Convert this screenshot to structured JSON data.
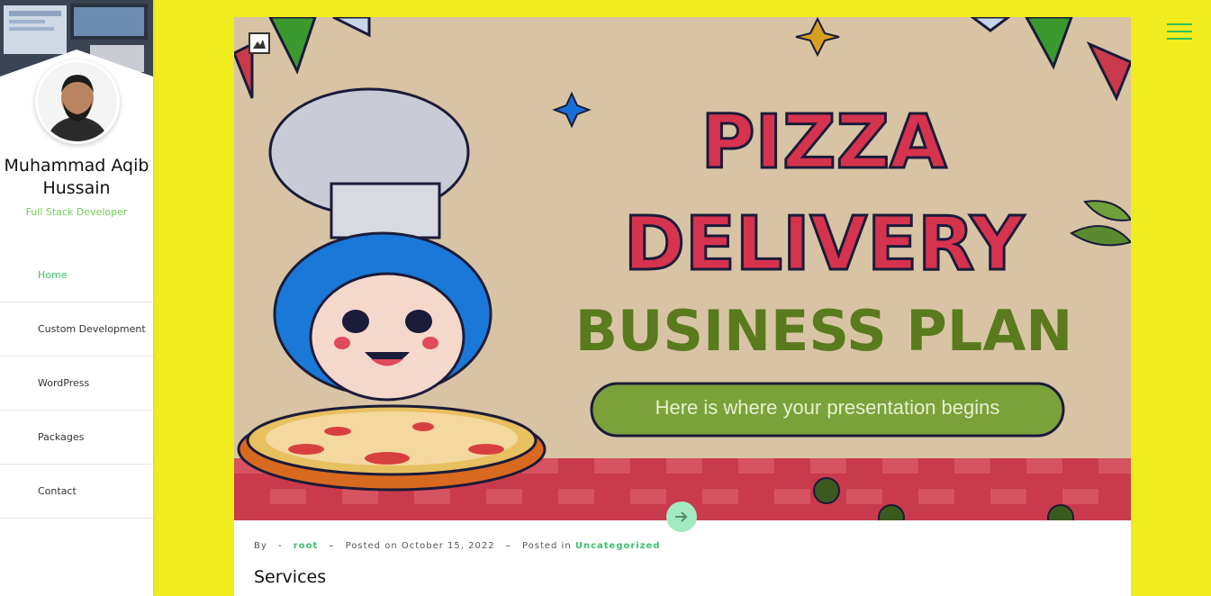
{
  "profile": {
    "name": "Muhammad Aqib Hussain",
    "role": "Full Stack Developer"
  },
  "nav": {
    "items": [
      {
        "label": "Home",
        "active": true
      },
      {
        "label": "Custom Development",
        "active": false
      },
      {
        "label": "WordPress",
        "active": false
      },
      {
        "label": "Packages",
        "active": false
      },
      {
        "label": "Contact",
        "active": false
      }
    ]
  },
  "hero": {
    "title_line1": "PIZZA",
    "title_line2": "DELIVERY",
    "title_line3": "BUSINESS PLAN",
    "subtitle": "Here is where your presentation begins"
  },
  "post": {
    "by_label": "By",
    "author": "root",
    "posted_on_label": "Posted on",
    "date": "October 15, 2022",
    "posted_in_label": "Posted in",
    "category": "Uncategorized",
    "title": "Services"
  },
  "icons": {
    "menu": "hamburger-icon",
    "next": "arrow-right-icon",
    "image": "image-icon"
  },
  "colors": {
    "background": "#f0ec1e",
    "accent": "#3fbf6a",
    "hero_bg": "#d8c4a4",
    "title_red": "#d6334f",
    "title_green": "#5a7a1e",
    "pill_green": "#7ba23a"
  }
}
